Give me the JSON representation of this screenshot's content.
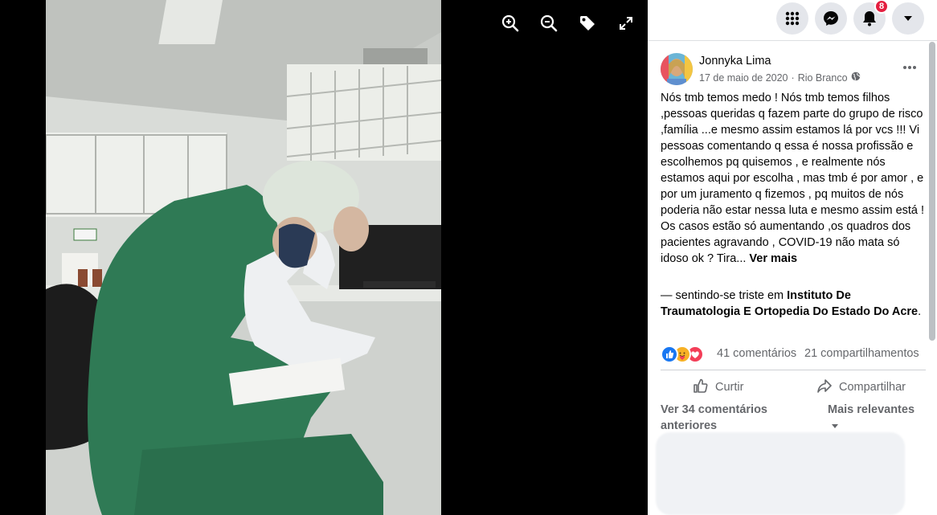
{
  "viewer": {
    "tools": [
      {
        "icon": "zoom-in-icon"
      },
      {
        "icon": "zoom-out-icon"
      },
      {
        "icon": "tag-icon"
      },
      {
        "icon": "fullscreen-icon"
      }
    ]
  },
  "topbar": {
    "menu_icon": "grid-menu-icon",
    "messenger_icon": "messenger-icon",
    "notifications_icon": "bell-icon",
    "notifications_count": "8",
    "account_icon": "caret-down-icon"
  },
  "post": {
    "author": "Jonnyka Lima",
    "date": "17 de maio de 2020",
    "separator": "·",
    "location": "Rio Branco",
    "audience_icon": "globe-icon",
    "text": "Nós tmb temos medo ! Nós tmb temos filhos ,pessoas queridas q fazem parte do grupo de risco ,família ...e mesmo assim estamos lá por vcs !!! Vi pessoas comentando q essa é nossa profissão e escolhemos pq quisemos , e realmente nós estamos aqui por escolha , mas tmb é por amor , e por um juramento q fizemos , pq muitos de nós poderia não estar nessa luta e mesmo assim está ! Os casos estão só aumentando ,os quadros dos pacientes agravando , COVID-19 não mata só idoso ok ? Tira...",
    "see_more": "Ver mais",
    "feeling_prefix": "— sentindo-se triste em ",
    "place": "Instituto De Traumatologia E Ortopedia Do Estado Do Acre",
    "place_suffix": "."
  },
  "stats": {
    "reactions": [
      "like",
      "care",
      "love"
    ],
    "comments": "41 comentários",
    "shares": "21 compartilhamentos"
  },
  "actions": {
    "like_label": "Curtir",
    "share_label": "Compartilhar"
  },
  "comments": {
    "previous_label": "Ver 34 comentários anteriores",
    "sort_label": "Mais relevantes"
  },
  "colors": {
    "like": "#1877f2",
    "love": "#f33e58",
    "care": "#f7b125",
    "badge": "#e41e3f"
  }
}
